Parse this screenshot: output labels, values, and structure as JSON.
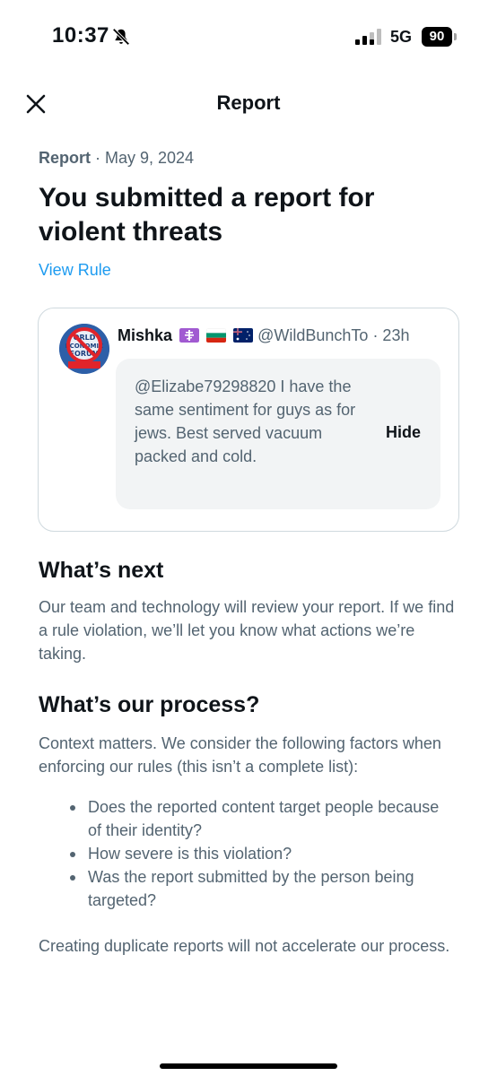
{
  "status_bar": {
    "time": "10:37",
    "network": "5G",
    "battery": "90"
  },
  "header": {
    "title": "Report",
    "close_icon": "close-icon"
  },
  "report": {
    "label": "Report",
    "date": "· May 9, 2024",
    "heading": "You submitted a report for violent threats",
    "view_rule": "View Rule"
  },
  "tweet": {
    "name": "Mishka",
    "handle": "@WildBunchTo",
    "time": "· 23h",
    "text": "@Elizabe79298820 I have the same sentiment for guys as for jews. Best served vacuum packed and cold.",
    "hide_label": "Hide",
    "avatar_text": "WORLD ECONOMIC FORUM"
  },
  "whats_next": {
    "heading": "What’s next",
    "text": "Our team and technology will review your report. If we find a rule violation, we’ll let you know what actions we’re taking."
  },
  "process": {
    "heading": "What’s our process?",
    "intro": "Context matters. We consider the following factors when enforcing our rules (this isn’t a complete list):",
    "bullets": [
      "Does the reported content target people because of their identity?",
      "How severe is this violation?",
      "Was the report submitted by the person being targeted?"
    ],
    "footer": "Creating duplicate reports will not accelerate our process."
  },
  "colors": {
    "link": "#1d9bf0",
    "secondary_text": "#536471",
    "primary_text": "#0f1419"
  }
}
